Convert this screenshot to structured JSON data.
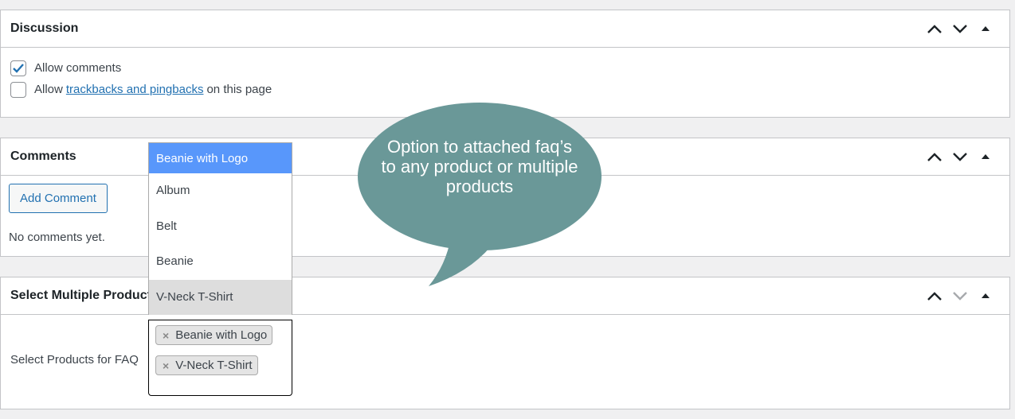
{
  "discussion": {
    "title": "Discussion",
    "allow_comments": {
      "label": "Allow comments",
      "checked": true
    },
    "allow_trackbacks": {
      "prefix": "Allow",
      "link_text": "trackbacks and pingbacks",
      "suffix": "on this page",
      "checked": false
    }
  },
  "comments": {
    "title": "Comments",
    "add_comment_label": "Add Comment",
    "empty_text": "No comments yet."
  },
  "select_products": {
    "title": "Select Multiple Products",
    "field_label": "Select Products for FAQ",
    "selected_tags": [
      {
        "label": "Beanie with Logo",
        "remove": "×"
      },
      {
        "label": "V-Neck T-Shirt",
        "remove": "×"
      }
    ]
  },
  "dropdown": {
    "options": [
      {
        "label": "Beanie with Logo",
        "state": "highlighted"
      },
      {
        "label": "Album",
        "state": "normal"
      },
      {
        "label": "Belt",
        "state": "normal"
      },
      {
        "label": "Beanie",
        "state": "normal"
      },
      {
        "label": "V-Neck T-Shirt",
        "state": "selected"
      }
    ]
  },
  "callout": {
    "text": "Option to attached faq’s to any product or multiple products",
    "color": "#6a9898"
  },
  "icons": {
    "move_up": "chevron-up-icon",
    "move_down": "chevron-down-icon",
    "toggle": "triangle-up-icon"
  },
  "colors": {
    "accent": "#2271b1",
    "highlight": "#5897fb",
    "page_bg": "#f0f0f1"
  }
}
